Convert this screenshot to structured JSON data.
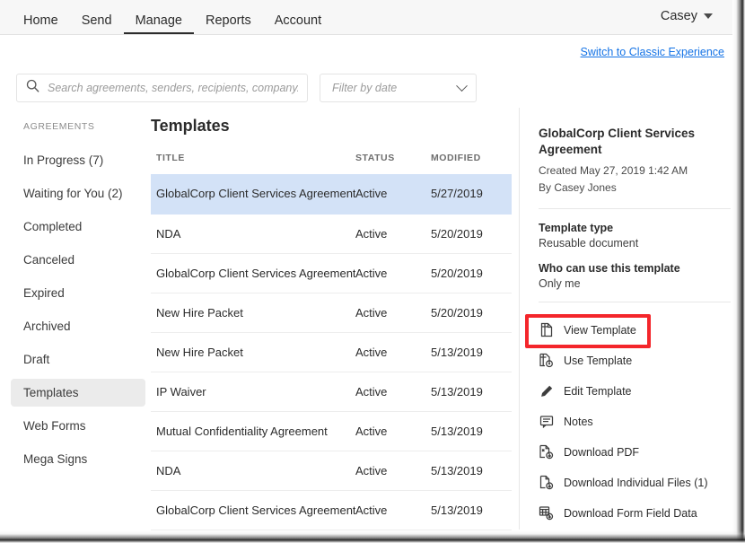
{
  "topnav": {
    "items": [
      {
        "label": "Home",
        "active": false
      },
      {
        "label": "Send",
        "active": false
      },
      {
        "label": "Manage",
        "active": true
      },
      {
        "label": "Reports",
        "active": false
      },
      {
        "label": "Account",
        "active": false
      }
    ],
    "account_name": "Casey",
    "caret_icon": "chevron-down-icon"
  },
  "classic_link": "Switch to Classic Experience",
  "search": {
    "placeholder": "Search agreements, senders, recipients, company...",
    "value": "",
    "icon": "search-icon"
  },
  "filter": {
    "label": "Filter by date",
    "icon": "chevron-down-icon"
  },
  "sidebar": {
    "heading": "AGREEMENTS",
    "items": [
      {
        "label": "In Progress (7)",
        "active": false
      },
      {
        "label": "Waiting for You (2)",
        "active": false
      },
      {
        "label": "Completed",
        "active": false
      },
      {
        "label": "Canceled",
        "active": false
      },
      {
        "label": "Expired",
        "active": false
      },
      {
        "label": "Archived",
        "active": false
      },
      {
        "label": "Draft",
        "active": false
      },
      {
        "label": "Templates",
        "active": true
      },
      {
        "label": "Web Forms",
        "active": false
      },
      {
        "label": "Mega Signs",
        "active": false
      }
    ]
  },
  "main": {
    "title": "Templates",
    "columns": [
      "TITLE",
      "STATUS",
      "MODIFIED"
    ],
    "rows": [
      {
        "title": "GlobalCorp Client Services Agreement",
        "status": "Active",
        "modified": "5/27/2019",
        "selected": true
      },
      {
        "title": "NDA",
        "status": "Active",
        "modified": "5/20/2019",
        "selected": false
      },
      {
        "title": "GlobalCorp Client Services Agreement",
        "status": "Active",
        "modified": "5/20/2019",
        "selected": false
      },
      {
        "title": "New Hire Packet",
        "status": "Active",
        "modified": "5/20/2019",
        "selected": false
      },
      {
        "title": "New Hire Packet",
        "status": "Active",
        "modified": "5/13/2019",
        "selected": false
      },
      {
        "title": "IP Waiver",
        "status": "Active",
        "modified": "5/13/2019",
        "selected": false
      },
      {
        "title": "Mutual Confidentiality Agreement",
        "status": "Active",
        "modified": "5/13/2019",
        "selected": false
      },
      {
        "title": "NDA",
        "status": "Active",
        "modified": "5/13/2019",
        "selected": false
      },
      {
        "title": "GlobalCorp Client Services Agreement",
        "status": "Active",
        "modified": "5/13/2019",
        "selected": false
      }
    ]
  },
  "detail": {
    "title": "GlobalCorp Client Services Agreement",
    "created": "Created May 27, 2019 1:42 AM",
    "by": "By Casey Jones",
    "type_label": "Template type",
    "type_value": "Reusable document",
    "who_label": "Who can use this template",
    "who_value": "Only me",
    "actions": [
      {
        "label": "View Template",
        "icon": "document-icon"
      },
      {
        "label": "Use Template",
        "icon": "document-gear-icon",
        "highlighted": true
      },
      {
        "label": "Edit Template",
        "icon": "pencil-icon"
      },
      {
        "label": "Notes",
        "icon": "note-bubble-icon"
      },
      {
        "label": "Download PDF",
        "icon": "download-pdf-icon"
      },
      {
        "label": "Download Individual Files (1)",
        "icon": "download-file-icon"
      },
      {
        "label": "Download Form Field Data",
        "icon": "download-form-data-icon"
      }
    ]
  },
  "colors": {
    "accent_link": "#1473e6",
    "row_selected": "#d3e2f7",
    "highlight_box": "#f4262b",
    "header_bg": "#f7f7f7"
  }
}
